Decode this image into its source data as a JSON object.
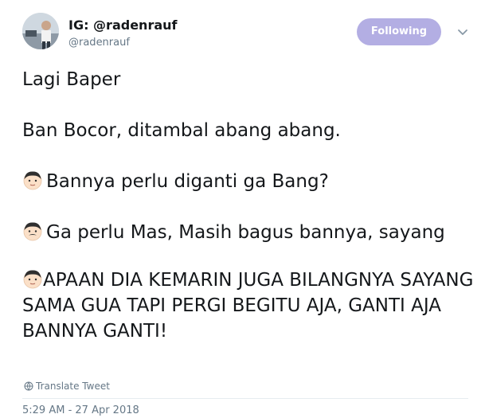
{
  "user": {
    "display_name": "IG: @radenrauf",
    "handle": "@radenrauf"
  },
  "follow_button": {
    "label": "Following",
    "color": "#b3aee3"
  },
  "menu_icon": "chevron-down-icon",
  "tweet": {
    "line1": "Lagi Baper",
    "line2": "Ban Bocor, ditambal abang abang.",
    "line3": "Bannya perlu diganti ga Bang?",
    "line4": "Ga perlu Mas, Masih bagus bannya, sayang",
    "line5": "APAAN DIA KEMARIN JUGA BILANGNYA SAYANG SAMA GUA TAPI PERGI BEGITU AJA, GANTI AJA BANNYA GANTI!",
    "emoji_customer": "boy-face-emoji",
    "emoji_mechanic": "man-with-mustache-face-emoji"
  },
  "translate_label": "Translate Tweet",
  "translate_icon": "globe-icon",
  "timestamp": "5:29 AM - 27 Apr 2018"
}
